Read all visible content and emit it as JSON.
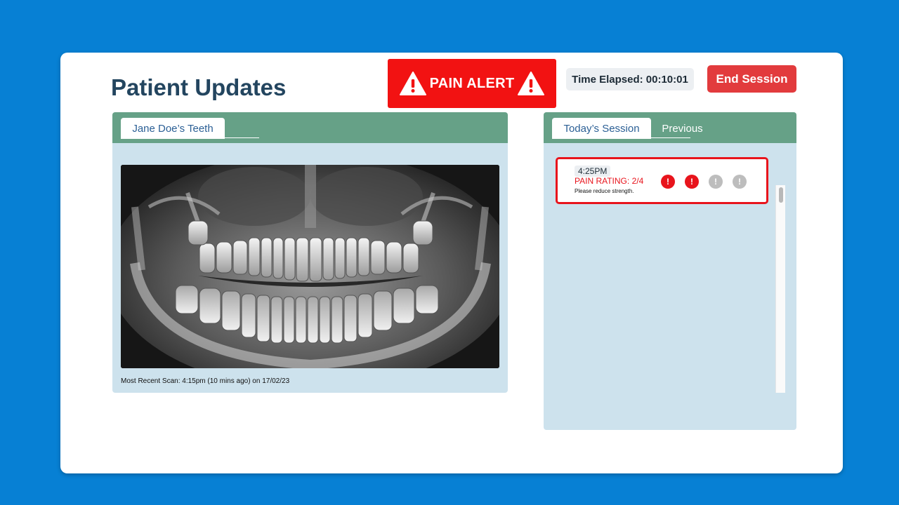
{
  "header": {
    "title": "Patient Updates",
    "pain_alert_label": "PAIN ALERT",
    "time_elapsed": "Time Elapsed: 00:10:01",
    "end_session_label": "End Session"
  },
  "xray_panel": {
    "tab_label": "Jane Doe’s Teeth",
    "scan_caption": "Most Recent Scan: 4:15pm (10 mins ago) on 17/02/23"
  },
  "session_panel": {
    "tabs": [
      {
        "label": "Today’s Session",
        "active": true
      },
      {
        "label": "Previous",
        "active": false
      }
    ],
    "entries": [
      {
        "time": "4:25PM",
        "rating": "PAIN RATING: 2/4",
        "note": "Please reduce strength.",
        "pain_level": 2,
        "pain_max": 4,
        "dot_glyph": "!"
      }
    ]
  },
  "icons": {
    "alert": "warning-triangle-icon",
    "pain_dot": "exclamation-circle-icon"
  },
  "colors": {
    "background": "#0780d4",
    "title": "#23455f",
    "alert_red": "#f21212",
    "end_button": "#e23b3d",
    "panel_header": "#66a187",
    "panel_body": "#cde2ed",
    "tab_text": "#2b5f95",
    "inactive_dot": "#bdbdbd"
  }
}
